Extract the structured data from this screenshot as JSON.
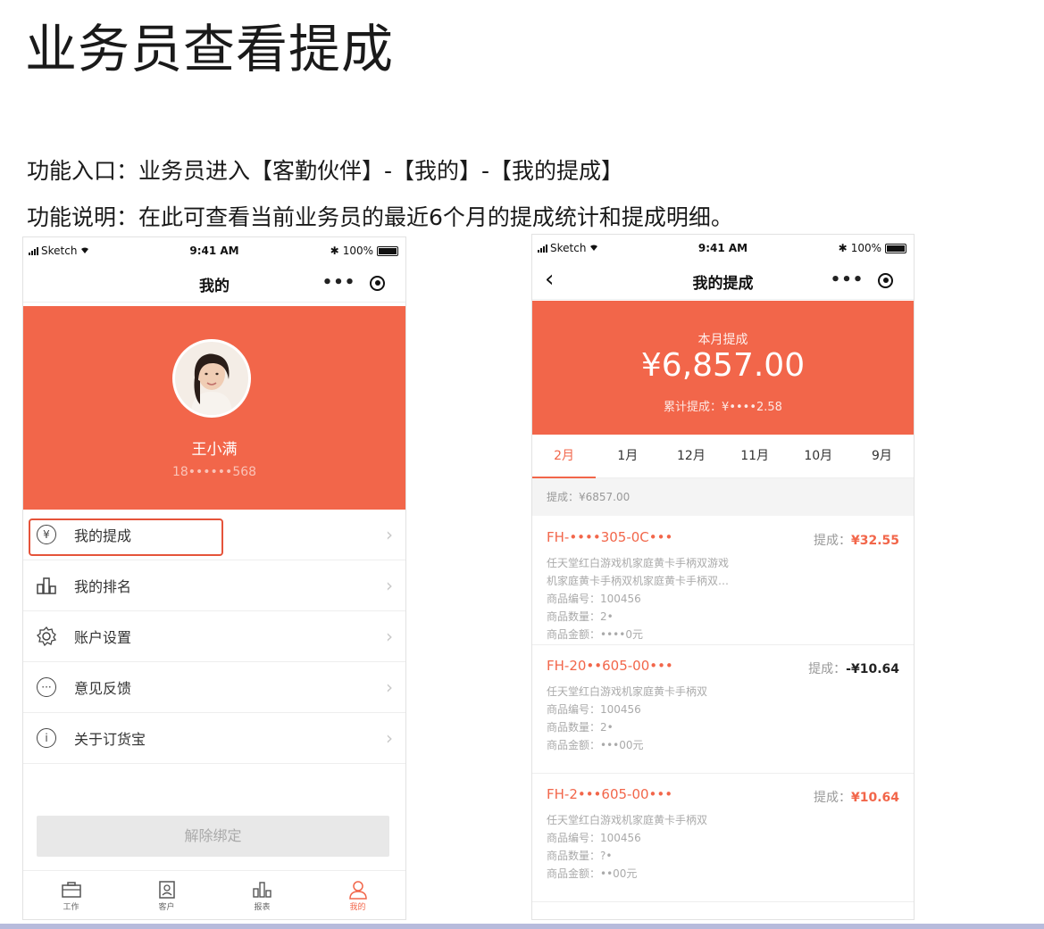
{
  "page": {
    "title": "业务员查看提成",
    "entry": "功能入口：业务员进入【客勤伙伴】-【我的】-【我的提成】",
    "description": "功能说明：在此可查看当前业务员的最近6个月的提成统计和提成明细。"
  },
  "left_phone": {
    "status": {
      "carrier": "Sketch",
      "time": "9:41 AM",
      "battery": "100%"
    },
    "nav": {
      "title": "我的",
      "more": "•••"
    },
    "profile": {
      "name": "王小满",
      "phone": "18••••••568"
    },
    "menu": [
      {
        "label": "我的提成",
        "icon": "yen-icon"
      },
      {
        "label": "我的排名",
        "icon": "ranking-icon"
      },
      {
        "label": "账户设置",
        "icon": "gear-icon"
      },
      {
        "label": "意见反馈",
        "icon": "feedback-icon"
      },
      {
        "label": "关于订货宝",
        "icon": "info-icon"
      }
    ],
    "arrow": "›",
    "unbind_label": "解除绑定",
    "tabs": [
      {
        "label": "工作",
        "icon": "briefcase-icon"
      },
      {
        "label": "客户",
        "icon": "contact-icon"
      },
      {
        "label": "报表",
        "icon": "report-icon"
      },
      {
        "label": "我的",
        "icon": "person-icon"
      }
    ]
  },
  "right_phone": {
    "status": {
      "carrier": "Sketch",
      "time": "9:41 AM",
      "battery": "100%"
    },
    "nav": {
      "title": "我的提成",
      "back": "‹",
      "more": "•••"
    },
    "header": {
      "label": "本月提成",
      "amount": "¥6,857.00",
      "total": "累计提成：¥••••2.58"
    },
    "months": [
      "2月",
      "1月",
      "12月",
      "11月",
      "10月",
      "9月"
    ],
    "summary": "提成：¥6857.00",
    "orders": [
      {
        "no": "FH-••••305-0C•••",
        "commission_label": "提成：",
        "commission": "¥32.55",
        "lines": [
          "任天堂红白游戏机家庭黄卡手柄双游戏",
          "机家庭黄卡手柄双机家庭黄卡手柄双…",
          "商品编号：100456",
          "商品数量：2•",
          "商品金额：••••0元"
        ]
      },
      {
        "no": "FH-20••605-00•••",
        "commission_label": "提成：",
        "commission": "-¥10.64",
        "lines": [
          "任天堂红白游戏机家庭黄卡手柄双",
          "商品编号：100456",
          "商品数量：2•",
          "商品金额：•••00元"
        ]
      },
      {
        "no": "FH-2•••605-00•••",
        "commission_label": "提成：",
        "commission": "¥10.64",
        "lines": [
          "任天堂红白游戏机家庭黄卡手柄双",
          "商品编号：100456",
          "商品数量：?•",
          "商品金额：••00元"
        ]
      }
    ]
  },
  "colors": {
    "accent": "#f2664a",
    "highlight_border": "#e5533a"
  }
}
